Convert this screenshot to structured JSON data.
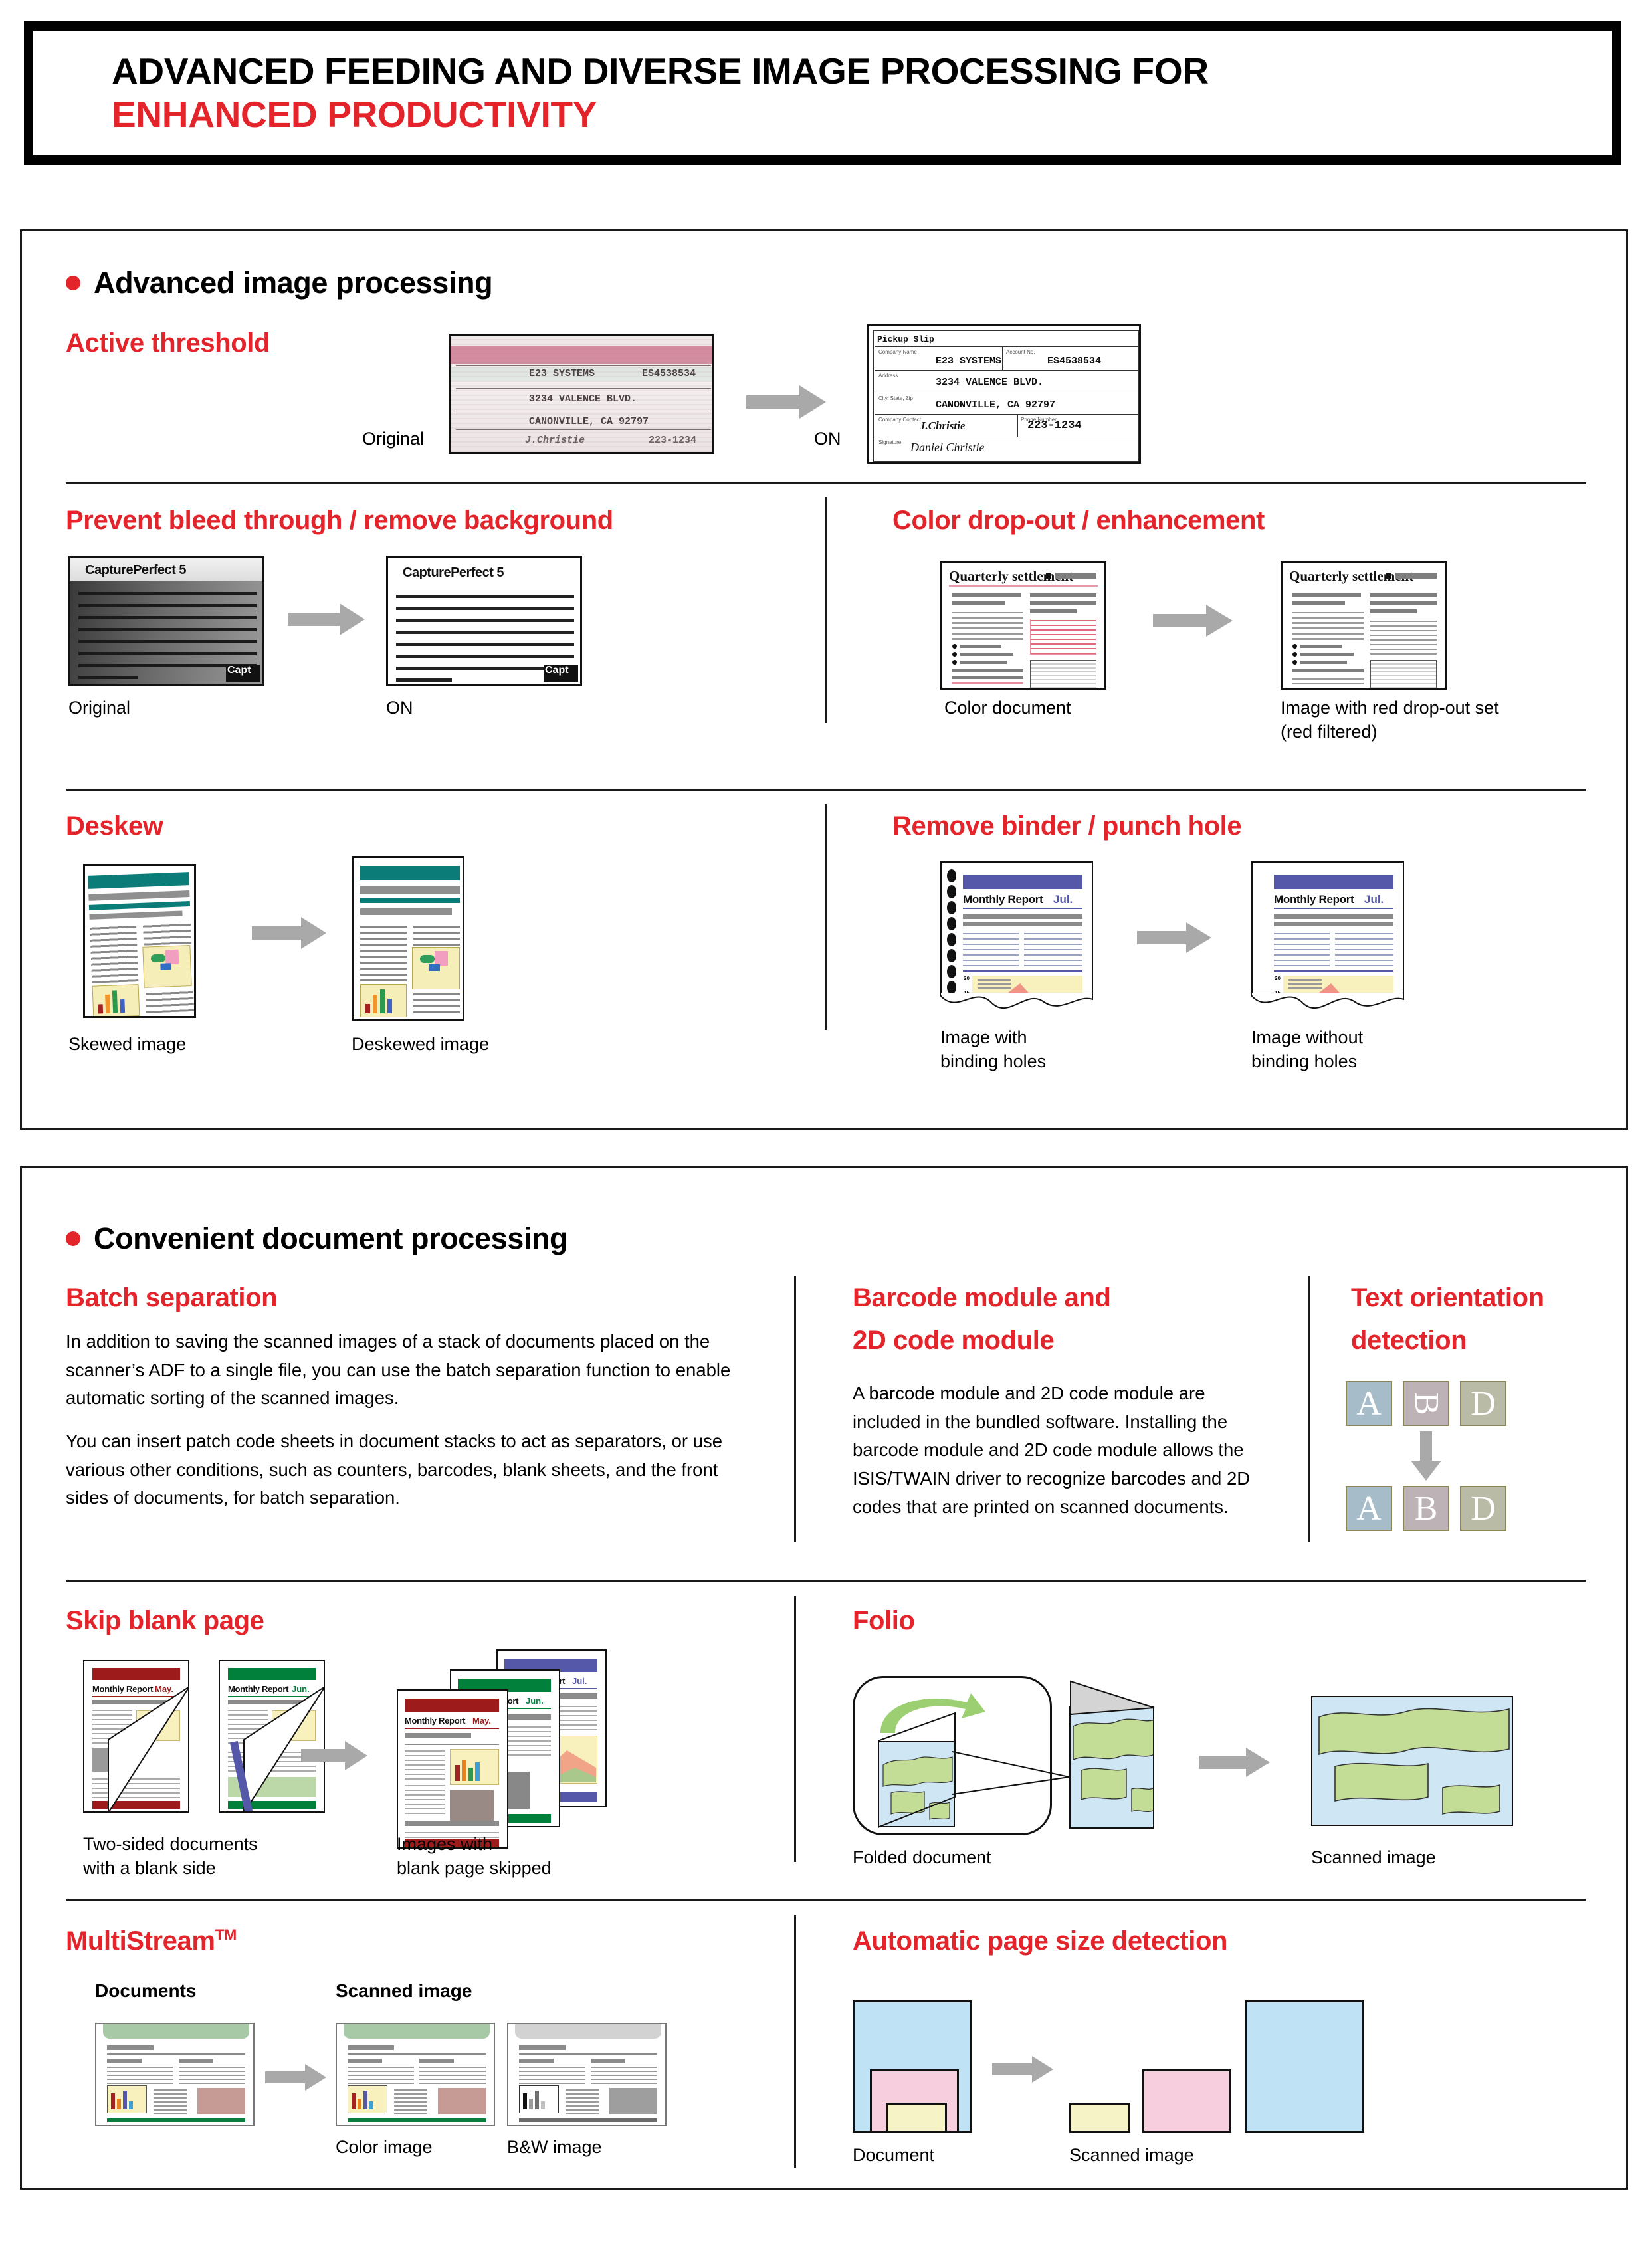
{
  "header": {
    "line1": "ADVANCED FEEDING AND DIVERSE IMAGE PROCESSING FOR",
    "line2": "ENHANCED PRODUCTIVITY",
    "accent_black": "#000000",
    "accent_red": "#E3242B"
  },
  "section1": {
    "title": "Advanced image processing",
    "features": {
      "active_threshold": {
        "title": "Active threshold",
        "caption_left": "Original",
        "caption_right": "ON",
        "receipt": {
          "heading": "Pickup Slip",
          "fields": [
            {
              "label": "Company Name",
              "value": "E23 SYSTEMS"
            },
            {
              "label": "Account No.",
              "value": "ES4538534"
            },
            {
              "label": "Address",
              "value": "3234 VALENCE BLVD."
            },
            {
              "label": "City, State, Zip",
              "value": "CANONVILLE, CA 92797"
            },
            {
              "label": "Company Contact",
              "value": "J. Christie"
            },
            {
              "label": "Phone Number",
              "value": "223-1234"
            },
            {
              "label": "Signature",
              "value": "Daniel Christie"
            }
          ]
        }
      },
      "prevent_bleed": {
        "title": "Prevent bleed through / remove background",
        "caption_left": "Original",
        "caption_right": "ON",
        "doc_title": "CapturePerfect 5",
        "doc_logo": "Capt"
      },
      "color_dropout": {
        "title": "Color drop-out / enhancement",
        "caption_left": "Color document",
        "caption_right_l1": "Image with red drop-out set",
        "caption_right_l2": "(red filtered)",
        "doc_title": "Quarterly settlement"
      },
      "deskew": {
        "title": "Deskew",
        "caption_left": "Skewed image",
        "caption_right": "Deskewed image"
      },
      "remove_binder": {
        "title": "Remove binder / punch hole",
        "caption_left_l1": "Image with",
        "caption_left_l2": "binding holes",
        "caption_right_l1": "Image without",
        "caption_right_l2": "binding holes",
        "doc_title": "Monthly Report",
        "doc_month": "Jul.",
        "chart_tick_top": "20",
        "chart_tick_bottom": "15"
      }
    }
  },
  "section2": {
    "title": "Convenient document processing",
    "features": {
      "batch_separation": {
        "title": "Batch separation",
        "paragraph1": "In addition to saving the scanned images of a stack of documents placed on the scanner’s ADF to a single file, you can use the batch separation function to enable automatic sorting of the scanned images.",
        "paragraph2": "You can insert patch code sheets in document stacks to act as separators, or use various other conditions, such as counters, barcodes, blank sheets, and the front sides of documents, for batch separation."
      },
      "barcode_module": {
        "title_l1": "Barcode module and",
        "title_l2": "2D code module",
        "paragraph": "A barcode module and 2D code module are included in the bundled software. Installing the barcode module and 2D code module allows the ISIS/TWAIN driver to recognize barcodes and 2D codes that are printed on scanned documents."
      },
      "text_orientation": {
        "title_l1": "Text orientation",
        "title_l2": "detection",
        "before_letters": [
          "A",
          "B",
          "D"
        ],
        "after_letters": [
          "A",
          "B",
          "D"
        ],
        "before_rotations": [
          0,
          90,
          0
        ],
        "after_rotations": [
          0,
          0,
          0
        ],
        "box_colors": [
          "#a6bcc9",
          "#bdb2b5",
          "#b9bba6"
        ]
      },
      "skip_blank_page": {
        "title": "Skip blank page",
        "caption_left_l1": "Two-sided documents",
        "caption_left_l2": "with a blank side",
        "caption_right_l1": "Images with",
        "caption_right_l2": "blank page skipped",
        "doc_title": "Monthly Report",
        "months": [
          "May.",
          "Jun.",
          "Jul."
        ],
        "month_colors": [
          "#9e1b1b",
          "#00803a",
          "#5154a8"
        ]
      },
      "folio": {
        "title": "Folio",
        "caption_left": "Folded document",
        "caption_right": "Scanned image"
      },
      "multistream": {
        "title": "MultiStream",
        "title_sup": "TM",
        "label_left": "Documents",
        "label_right": "Scanned image",
        "caption_color": "Color image",
        "caption_bw": "B&W image"
      },
      "auto_page_size": {
        "title": "Automatic page size detection",
        "caption_left": "Document",
        "caption_right": "Scanned image",
        "sheet_colors": [
          "#bfe2f5",
          "#f7cede",
          "#f6f4c6"
        ]
      }
    }
  }
}
